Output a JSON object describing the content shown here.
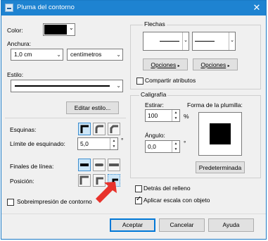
{
  "dialog": {
    "title": "Pluma del contorno",
    "close_glyph": "✕"
  },
  "left": {
    "color_label": "Color:",
    "color_swatch": "#000000",
    "anchura_label": "Anchura:",
    "anchura_value": "1,0 cm",
    "units_value": "centímetros",
    "estilo_label": "Estilo:",
    "editar_estilo_label": "Editar estilo...",
    "esquinas_label": "Esquinas:",
    "limite_label": "Límite de esquinado:",
    "limite_value": "5,0",
    "limite_unit": "°",
    "finales_label": "Finales de línea:",
    "posicion_label": "Posición:",
    "sobreimpresion_label": "Sobreimpresión de contorno"
  },
  "right": {
    "flechas_label": "Flechas",
    "opciones_left": "Opciones",
    "opciones_right": "Opciones",
    "compartir_label": "Compartir atributos",
    "caligrafia_label": "Caligrafía",
    "estirar_label": "Estirar:",
    "estirar_value": "100",
    "estirar_unit": "%",
    "forma_label": "Forma de la plumilla:",
    "angulo_label": "Ángulo:",
    "angulo_value": "0,0",
    "angulo_unit": "°",
    "predeterminada_label": "Predeterminada",
    "detras_label": "Detrás del relleno",
    "aplicar_label": "Aplicar escala con objeto"
  },
  "footer": {
    "aceptar_label": "Aceptar",
    "cancelar_label": "Cancelar",
    "ayuda_label": "Ayuda"
  },
  "annotation": {
    "arrow_color": "#e8322b"
  }
}
